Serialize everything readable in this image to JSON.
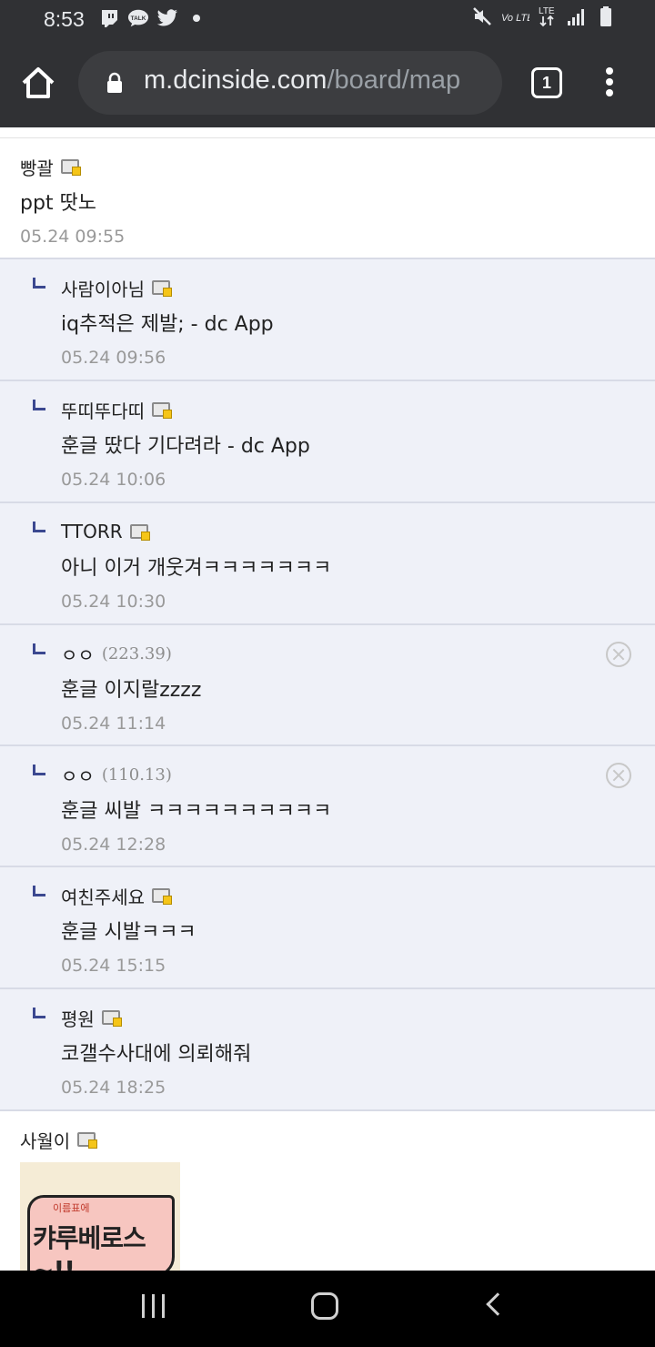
{
  "status_bar": {
    "time": "8:53",
    "left_icons": [
      "twitch-icon",
      "kakaotalk-icon",
      "twitter-icon",
      "dot-icon"
    ],
    "kakaotalk_label": "TALK",
    "right_icons": [
      "mute-icon",
      "volte-icon",
      "lte-icon",
      "signal-icon",
      "battery-icon"
    ],
    "volte_label": "Vo LTE",
    "lte_label": "LTE"
  },
  "browser": {
    "url_host": "m.dcinside.com",
    "url_path": "/board/map",
    "tab_count": "1"
  },
  "comments": [
    {
      "nick": "빵괄",
      "ip": "",
      "gallog": true,
      "text": "ppt 땃노",
      "date": "05.24 09:55",
      "reply": false,
      "deletable": false
    },
    {
      "nick": "사람이아님",
      "ip": "",
      "gallog": true,
      "text": "iq추적은 제발; - dc App",
      "date": "05.24 09:56",
      "reply": true,
      "deletable": false
    },
    {
      "nick": "뚜띠뚜다띠",
      "ip": "",
      "gallog": true,
      "text": "훈글 땄다 기다려라 - dc App",
      "date": "05.24 10:06",
      "reply": true,
      "deletable": false
    },
    {
      "nick": "TTORR",
      "ip": "",
      "gallog": true,
      "text": "아니 이거 개웃겨ㅋㅋㅋㅋㅋㅋㅋ",
      "date": "05.24 10:30",
      "reply": true,
      "deletable": false
    },
    {
      "nick": "ㅇㅇ",
      "ip": "(223.39)",
      "gallog": false,
      "text": "훈글 이지랄zzzz",
      "date": "05.24 11:14",
      "reply": true,
      "deletable": true
    },
    {
      "nick": "ㅇㅇ",
      "ip": "(110.13)",
      "gallog": false,
      "text": "훈글 씨발 ㅋㅋㅋㅋㅋㅋㅋㅋㅋㅋ",
      "date": "05.24 12:28",
      "reply": true,
      "deletable": true
    },
    {
      "nick": "여친주세요",
      "ip": "",
      "gallog": true,
      "text": "훈글 시발ㅋㅋㅋ",
      "date": "05.24 15:15",
      "reply": true,
      "deletable": false
    },
    {
      "nick": "평원",
      "ip": "",
      "gallog": true,
      "text": "코갤수사대에 의뢰해줘",
      "date": "05.24 18:25",
      "reply": true,
      "deletable": false
    }
  ],
  "last_comment": {
    "nick": "사월이",
    "gallog": true,
    "dccon_small": "이름표에",
    "dccon_text": "캬루베로스~!!"
  },
  "nav": {
    "buttons": [
      "recent-apps-button",
      "home-button",
      "back-button"
    ]
  }
}
